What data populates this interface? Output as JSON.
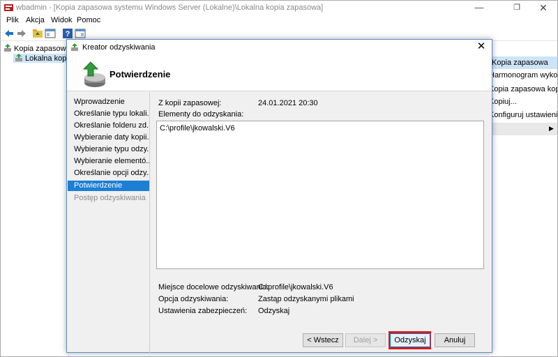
{
  "window": {
    "title": "wbadmin - [Kopia zapasowa systemu Windows Server (Lokalne)\\Lokalna kopia zapasowa]",
    "minimize": "—",
    "maximize": "❐",
    "close": "✕"
  },
  "menu": [
    "Plik",
    "Akcja",
    "Widok",
    "Pomoc"
  ],
  "tree": {
    "root": "Kopia zapasowa sys",
    "child": "Lokalna kopia"
  },
  "actions": {
    "header": "Kopia zapasowa",
    "items": [
      "Harmonogram wykon...",
      "Kopia zapasowa kopia zap...",
      "Kopiuj...",
      "Konfiguruj ustawienia ..."
    ]
  },
  "dialog": {
    "title": "Kreator odzyskiwania",
    "heading": "Potwierdzenie",
    "close": "✕",
    "steps": [
      "Wprowadzenie",
      "Określanie typu lokali...",
      "Określanie folderu zd...",
      "Wybieranie daty kopii...",
      "Wybieranie typu odzy...",
      "Wybieranie elementó...",
      "Określanie opcji odzy...",
      "Potwierdzenie",
      "Postęp odzyskiwania"
    ],
    "backup_label": "Z kopii zapasowej:",
    "backup_value": "24.01.2021 20:30",
    "items_label": "Elementy do odzyskania:",
    "items": [
      "C:\\profile\\jkowalski.V6"
    ],
    "destination_label": "Miejsce docelowe odzyskiwania:",
    "destination_value": "C:\\profile\\jkowalski.V6",
    "option_label": "Opcja odzyskiwania:",
    "option_value": "Zastąp odzyskanymi plikami",
    "security_label": "Ustawienia zabezpieczeń:",
    "security_value": "Odzyskaj",
    "buttons": {
      "back": "< Wstecz",
      "next": "Dalej >",
      "recover": "Odzyskaj",
      "cancel": "Anuluj"
    }
  },
  "colors": {
    "accent": "#1b7fd4",
    "highlight": "#e01818",
    "selection": "#cce4f7"
  }
}
